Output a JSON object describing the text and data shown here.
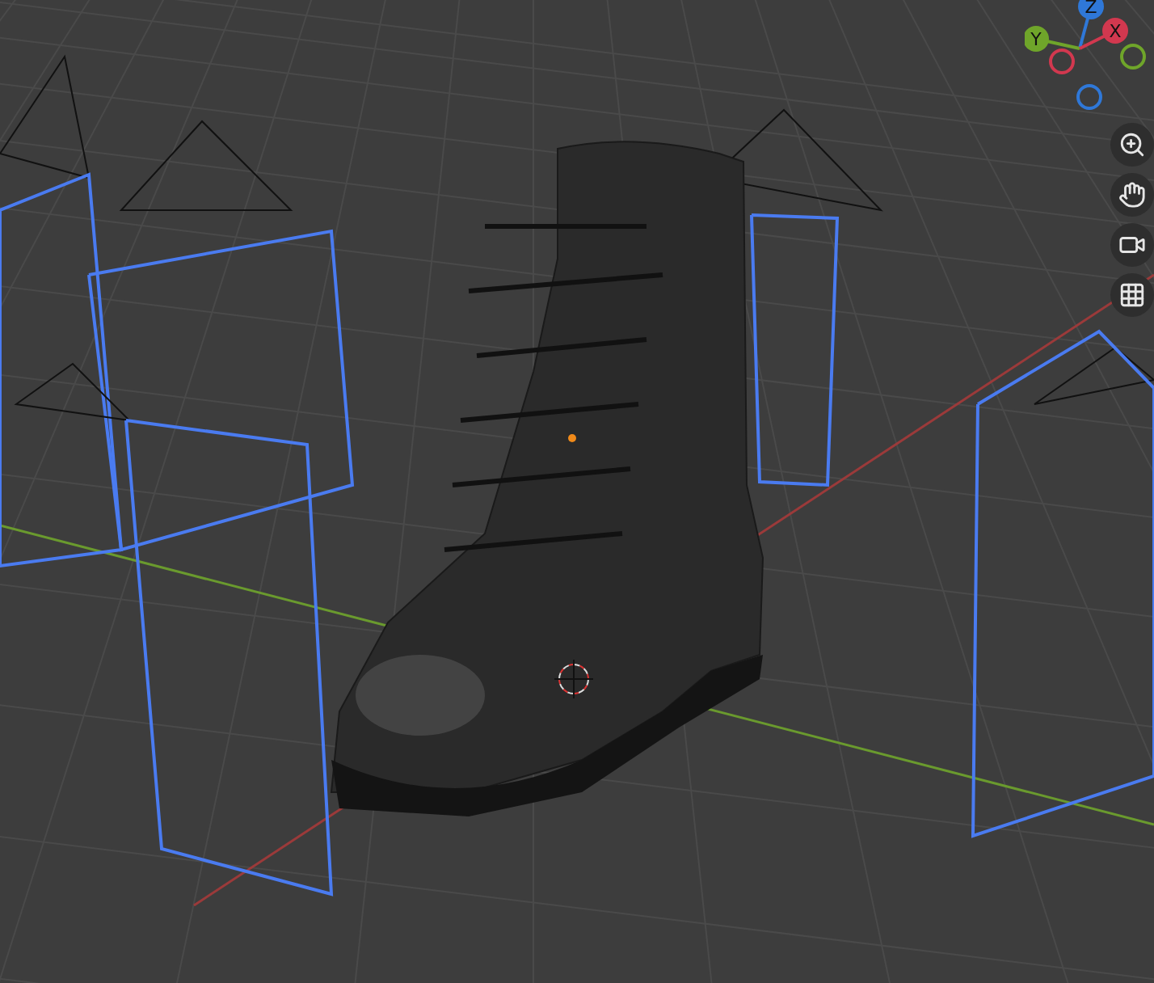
{
  "gizmo": {
    "axes": [
      {
        "label": "Z",
        "color": "#2f78d8",
        "kind": "labeled"
      },
      {
        "label": "Y",
        "color": "#6fa52a",
        "kind": "labeled"
      },
      {
        "label": "X",
        "color": "#d2384f",
        "kind": "labeled"
      },
      {
        "color": "#d2384f",
        "kind": "ring"
      },
      {
        "color": "#6fa52a",
        "kind": "ring"
      },
      {
        "color": "#2f78d8",
        "kind": "ring"
      }
    ]
  }
}
